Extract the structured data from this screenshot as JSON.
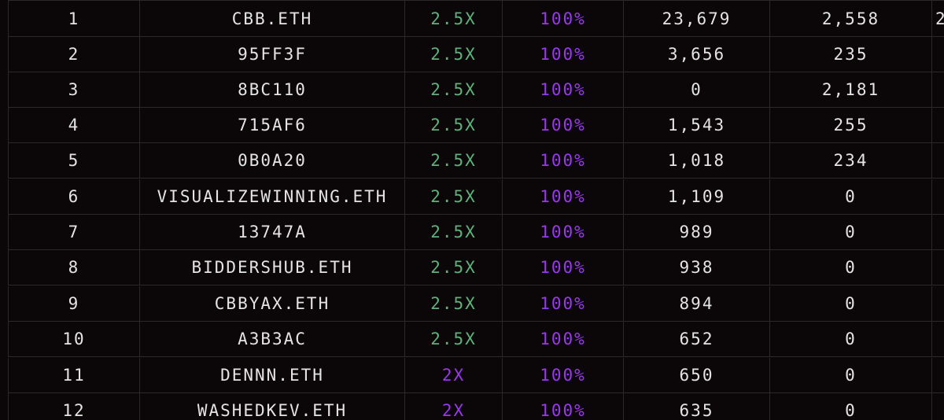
{
  "colors": {
    "background": "#0b0709",
    "text": "#e4e4e4",
    "green": "#5fb27c",
    "purple": "#9b37f0",
    "grid": "#2a282a"
  },
  "rows": [
    {
      "rank": "1",
      "name": "CBB.ETH",
      "mult": "2.5X",
      "mult_color": "green",
      "pct": "100%",
      "v1": "23,679",
      "v2": "2,558",
      "v3": "2"
    },
    {
      "rank": "2",
      "name": "95FF3F",
      "mult": "2.5X",
      "mult_color": "green",
      "pct": "100%",
      "v1": "3,656",
      "v2": "235",
      "v3": ""
    },
    {
      "rank": "3",
      "name": "8BC110",
      "mult": "2.5X",
      "mult_color": "green",
      "pct": "100%",
      "v1": "0",
      "v2": "2,181",
      "v3": ""
    },
    {
      "rank": "4",
      "name": "715AF6",
      "mult": "2.5X",
      "mult_color": "green",
      "pct": "100%",
      "v1": "1,543",
      "v2": "255",
      "v3": ""
    },
    {
      "rank": "5",
      "name": "0B0A20",
      "mult": "2.5X",
      "mult_color": "green",
      "pct": "100%",
      "v1": "1,018",
      "v2": "234",
      "v3": ""
    },
    {
      "rank": "6",
      "name": "VISUALIZEWINNING.ETH",
      "mult": "2.5X",
      "mult_color": "green",
      "pct": "100%",
      "v1": "1,109",
      "v2": "0",
      "v3": ""
    },
    {
      "rank": "7",
      "name": "13747A",
      "mult": "2.5X",
      "mult_color": "green",
      "pct": "100%",
      "v1": "989",
      "v2": "0",
      "v3": ""
    },
    {
      "rank": "8",
      "name": "BIDDERSHUB.ETH",
      "mult": "2.5X",
      "mult_color": "green",
      "pct": "100%",
      "v1": "938",
      "v2": "0",
      "v3": ""
    },
    {
      "rank": "9",
      "name": "CBBYAX.ETH",
      "mult": "2.5X",
      "mult_color": "green",
      "pct": "100%",
      "v1": "894",
      "v2": "0",
      "v3": ""
    },
    {
      "rank": "10",
      "name": "A3B3AC",
      "mult": "2.5X",
      "mult_color": "green",
      "pct": "100%",
      "v1": "652",
      "v2": "0",
      "v3": ""
    },
    {
      "rank": "11",
      "name": "DENNN.ETH",
      "mult": "2X",
      "mult_color": "purple",
      "pct": "100%",
      "v1": "650",
      "v2": "0",
      "v3": ""
    },
    {
      "rank": "12",
      "name": "WASHEDKEV.ETH",
      "mult": "2X",
      "mult_color": "purple",
      "pct": "100%",
      "v1": "635",
      "v2": "0",
      "v3": ""
    }
  ]
}
